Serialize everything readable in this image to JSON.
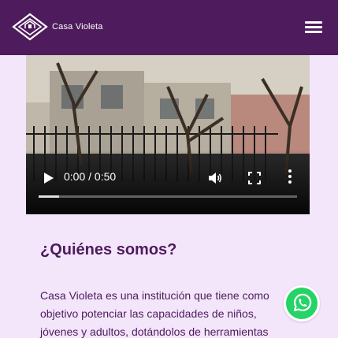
{
  "header": {
    "brand": "Casa Violeta",
    "logo_icon": "diamond-house-logo",
    "menu_icon": "hamburger-menu-icon",
    "background": "#4e1b5c"
  },
  "video": {
    "time": "0:00 / 0:50",
    "progress": 0.08,
    "icons": [
      "play-icon",
      "volume-icon",
      "fullscreen-icon",
      "more-options-icon"
    ]
  },
  "about": {
    "title": "¿Quiénes somos?",
    "lines": [
      "Casa Violeta es una institución que tiene como",
      "objetivo potenciar las capacidades de niños,",
      "jóvenes y adultos, dotándolos de herramientas"
    ]
  },
  "whatsapp": {
    "icon": "whatsapp-icon",
    "color": "#25d366"
  },
  "colors": {
    "page_background": "#f3e6fb",
    "text": "#4e1b5c"
  }
}
